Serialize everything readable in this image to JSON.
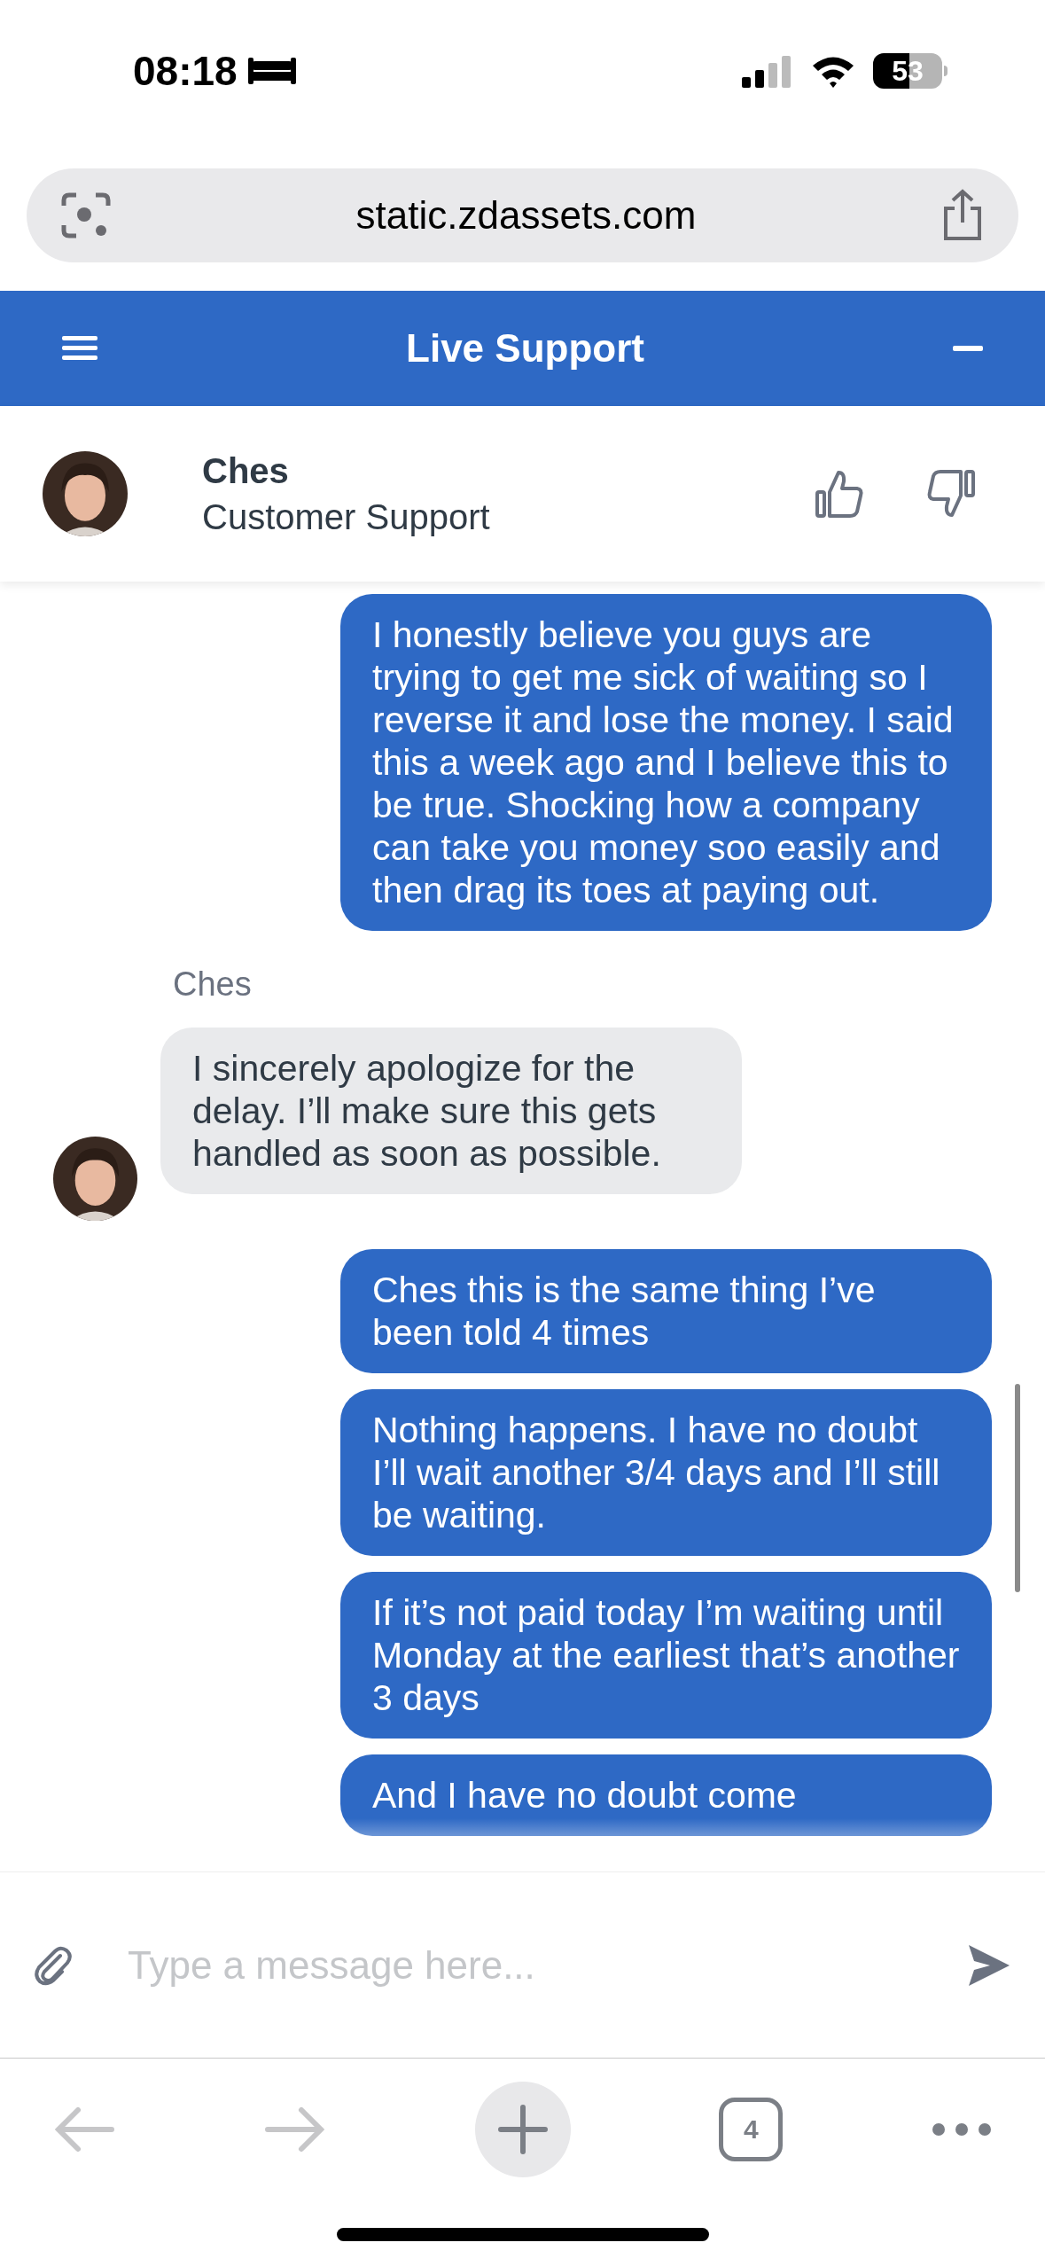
{
  "status_bar": {
    "time": "08:18",
    "battery": "53"
  },
  "browser": {
    "url": "static.zdassets.com",
    "tab_count": "4"
  },
  "chat_header": {
    "title": "Live Support"
  },
  "agent": {
    "name": "Ches",
    "role": "Customer Support"
  },
  "messages": [
    {
      "kind": "sent",
      "text": "I honestly believe you guys are trying to get me sick of waiting so I reverse it and lose the money. I said this a week ago and I believe this to be true. Shocking how a company can take you money soo easily and then drag its toes at paying out."
    },
    {
      "kind": "received",
      "sender": "Ches",
      "text": "I sincerely apologize for the delay. I’ll make sure this gets handled as soon as possible."
    },
    {
      "kind": "sent",
      "text": "Ches this is the same thing I’ve been told 4 times"
    },
    {
      "kind": "sent",
      "text": "Nothing happens. I have no doubt I’ll wait another 3/4 days and I’ll still be waiting."
    },
    {
      "kind": "sent",
      "text": "If it’s not paid today I’m waiting until Monday at the earliest that’s another 3 days"
    },
    {
      "kind": "sent",
      "text": "And I have no doubt come"
    }
  ],
  "composer": {
    "placeholder": "Type a message here..."
  }
}
